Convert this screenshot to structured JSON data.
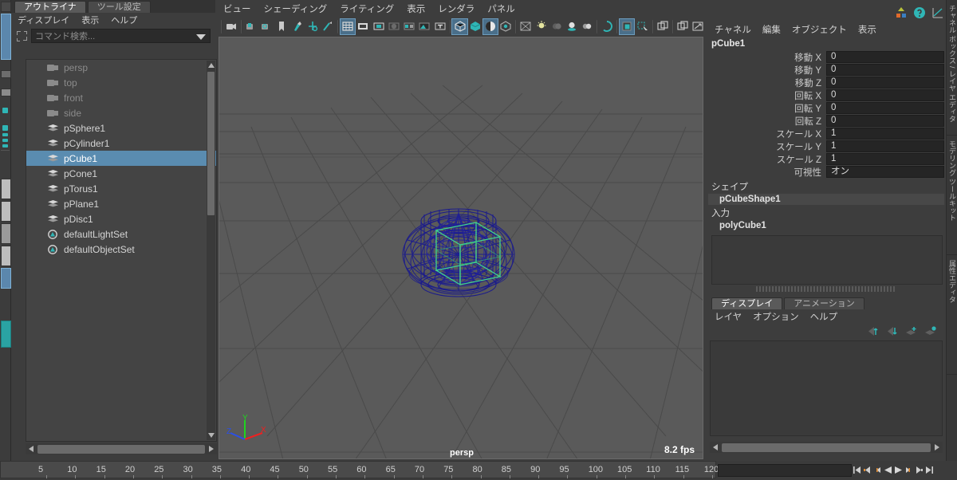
{
  "app": {
    "name": "maya-3d-editor"
  },
  "outliner": {
    "tabs": [
      {
        "label": "アウトライナ",
        "active": true
      },
      {
        "label": "ツール設定",
        "active": false
      }
    ],
    "menus": [
      "ディスプレイ",
      "表示",
      "ヘルプ"
    ],
    "search": {
      "placeholder": "コマンド検索...",
      "value": ""
    },
    "items": [
      {
        "label": "persp",
        "icon": "camera-icon",
        "dim": true,
        "selected": false
      },
      {
        "label": "top",
        "icon": "camera-icon",
        "dim": true,
        "selected": false
      },
      {
        "label": "front",
        "icon": "camera-icon",
        "dim": true,
        "selected": false
      },
      {
        "label": "side",
        "icon": "camera-icon",
        "dim": true,
        "selected": false
      },
      {
        "label": "pSphere1",
        "icon": "mesh-icon",
        "dim": false,
        "selected": false
      },
      {
        "label": "pCylinder1",
        "icon": "mesh-icon",
        "dim": false,
        "selected": false
      },
      {
        "label": "pCube1",
        "icon": "mesh-icon",
        "dim": false,
        "selected": true
      },
      {
        "label": "pCone1",
        "icon": "mesh-icon",
        "dim": false,
        "selected": false
      },
      {
        "label": "pTorus1",
        "icon": "mesh-icon",
        "dim": false,
        "selected": false
      },
      {
        "label": "pPlane1",
        "icon": "mesh-icon",
        "dim": false,
        "selected": false
      },
      {
        "label": "pDisc1",
        "icon": "mesh-icon",
        "dim": false,
        "selected": false
      },
      {
        "label": "defaultLightSet",
        "icon": "set-icon",
        "dim": false,
        "selected": false
      },
      {
        "label": "defaultObjectSet",
        "icon": "set-icon",
        "dim": false,
        "selected": false
      }
    ]
  },
  "viewport": {
    "menus": [
      "ビュー",
      "シェーディング",
      "ライティング",
      "表示",
      "レンダラ",
      "パネル"
    ],
    "camera_label": "persp",
    "fps": "8.2 fps",
    "axis": {
      "x": "X",
      "y": "Y",
      "z": "Z"
    },
    "toolbar": [
      {
        "name": "camera-select-icon",
        "on": false
      },
      {
        "name": "camera-lock-icon",
        "on": false
      },
      {
        "name": "camera-attributes-icon",
        "on": false
      },
      {
        "name": "bookmark-icon",
        "on": false
      },
      {
        "name": "paint-effects-icon",
        "on": false
      },
      {
        "name": "move-tool-icon",
        "on": false
      },
      {
        "name": "stroke-tool-icon",
        "on": false
      },
      {
        "name": "grid-toggle-icon",
        "on": true
      },
      {
        "name": "film-gate-icon",
        "on": false
      },
      {
        "name": "resolution-gate-icon",
        "on": false
      },
      {
        "name": "gate-mask-icon",
        "on": false
      },
      {
        "name": "film-origin-icon",
        "on": false
      },
      {
        "name": "image-plane-icon",
        "on": false
      },
      {
        "name": "hud-text-icon",
        "on": false
      },
      {
        "name": "wireframe-shading-icon",
        "on": true
      },
      {
        "name": "smooth-shade-all-icon",
        "on": false
      },
      {
        "name": "shaded-wireframe-icon",
        "on": true
      },
      {
        "name": "textured-shading-icon",
        "on": false
      },
      {
        "name": "use-default-material-icon",
        "on": false
      },
      {
        "name": "lighting-icon",
        "on": false
      },
      {
        "name": "shadows-icon",
        "on": false
      },
      {
        "name": "ao-icon",
        "on": false
      },
      {
        "name": "motion-blur-icon",
        "on": false
      },
      {
        "name": "aa-toggle-icon",
        "on": false
      },
      {
        "name": "exposure-icon",
        "on": true
      },
      {
        "name": "isolate-select-icon",
        "on": false
      },
      {
        "name": "xray-icon",
        "on": false
      },
      {
        "name": "xray-joints-icon",
        "on": false
      },
      {
        "name": "view-transform-icon",
        "on": false
      }
    ]
  },
  "channelbox": {
    "menus": [
      "チャネル",
      "編集",
      "オブジェクト",
      "表示"
    ],
    "object_name": "pCube1",
    "attributes": [
      {
        "label": "移動 X",
        "value": "0"
      },
      {
        "label": "移動 Y",
        "value": "0"
      },
      {
        "label": "移動 Z",
        "value": "0"
      },
      {
        "label": "回転 X",
        "value": "0"
      },
      {
        "label": "回転 Y",
        "value": "0"
      },
      {
        "label": "回転 Z",
        "value": "0"
      },
      {
        "label": "スケール X",
        "value": "1"
      },
      {
        "label": "スケール Y",
        "value": "1"
      },
      {
        "label": "スケール Z",
        "value": "1"
      },
      {
        "label": "可視性",
        "value": "オン"
      }
    ],
    "shape_header": "シェイプ",
    "shape_node": "pCubeShape1",
    "inputs_header": "入力",
    "input_node": "polyCube1"
  },
  "layer_editor": {
    "tabs": [
      {
        "label": "ディスプレイ",
        "active": true
      },
      {
        "label": "アニメーション",
        "active": false
      }
    ],
    "menus": [
      "レイヤ",
      "オプション",
      "ヘルプ"
    ],
    "buttons": [
      "layer-move-up-icon",
      "layer-move-down-icon",
      "layer-new-icon",
      "layer-new-from-selected-icon"
    ]
  },
  "right_vertical_tabs": [
    "チャネル ボックス / レイヤ エディタ",
    "モデリング ツールキット",
    "属性エディタ"
  ],
  "top_right_icons": [
    "workspace-icon",
    "help-icon",
    "graph-editor-icon"
  ],
  "timeline": {
    "ticks": [
      5,
      10,
      15,
      20,
      25,
      30,
      35,
      40,
      45,
      50,
      55,
      60,
      65,
      70,
      75,
      80,
      85,
      90,
      95,
      100,
      105,
      110,
      115,
      120
    ],
    "current_frame": "",
    "playback_buttons": [
      "go-to-start-icon",
      "step-back-frame-icon",
      "step-back-key-icon",
      "play-backwards-icon",
      "play-forwards-icon",
      "step-forward-key-icon",
      "step-forward-frame-icon",
      "go-to-end-icon"
    ]
  },
  "colors": {
    "accent": "#5a8cb0",
    "teal": "#2fb6b6",
    "panel_bg": "#3d3d3d",
    "viewport_bg": "#5a5a5a",
    "wire": "#1b1b8c",
    "selected_wire": "#3fd48f"
  }
}
